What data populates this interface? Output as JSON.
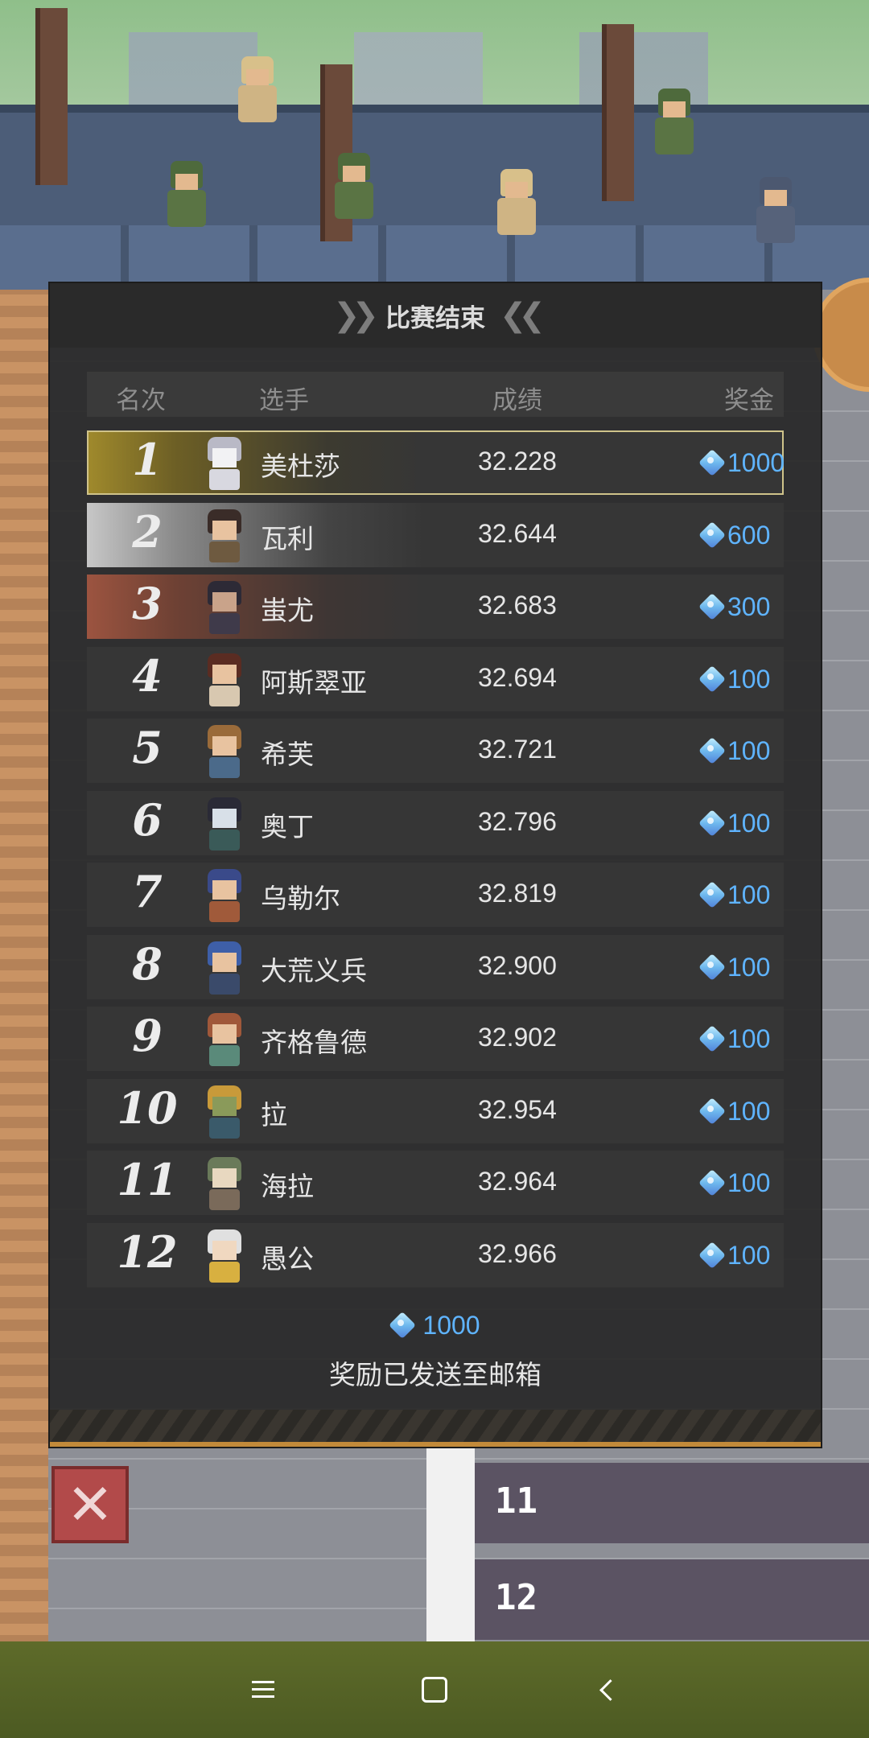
{
  "panel": {
    "title": "比赛结束"
  },
  "table": {
    "headers": {
      "rank": "名次",
      "player": "选手",
      "score": "成绩",
      "prize": "奖金"
    },
    "rows": [
      {
        "rank": "1",
        "name": "美杜莎",
        "score": "32.228",
        "prize": "1000"
      },
      {
        "rank": "2",
        "name": "瓦利",
        "score": "32.644",
        "prize": "600"
      },
      {
        "rank": "3",
        "name": "蚩尤",
        "score": "32.683",
        "prize": "300"
      },
      {
        "rank": "4",
        "name": "阿斯翠亚",
        "score": "32.694",
        "prize": "100"
      },
      {
        "rank": "5",
        "name": "希芙",
        "score": "32.721",
        "prize": "100"
      },
      {
        "rank": "6",
        "name": "奥丁",
        "score": "32.796",
        "prize": "100"
      },
      {
        "rank": "7",
        "name": "乌勒尔",
        "score": "32.819",
        "prize": "100"
      },
      {
        "rank": "8",
        "name": "大荒义兵",
        "score": "32.900",
        "prize": "100"
      },
      {
        "rank": "9",
        "name": "齐格鲁德",
        "score": "32.902",
        "prize": "100"
      },
      {
        "rank": "10",
        "name": "拉",
        "score": "32.954",
        "prize": "100"
      },
      {
        "rank": "11",
        "name": "海拉",
        "score": "32.964",
        "prize": "100"
      },
      {
        "rank": "12",
        "name": "愚公",
        "score": "32.966",
        "prize": "100"
      }
    ]
  },
  "reward": {
    "total": "1000",
    "note": "奖励已发送至邮箱"
  },
  "lanes": {
    "lane_11": "11",
    "lane_12": "12"
  },
  "colors": {
    "gem_text": "#5fb4ff",
    "gold": "#a08a2c",
    "silver": "#c7c7c7",
    "bronze": "#9c5440",
    "close_button": "#b24a4a"
  },
  "icons": {
    "close": "close-icon",
    "gem": "gem-icon",
    "nav_menu": "menu-icon",
    "nav_home": "home-icon",
    "nav_back": "back-icon"
  }
}
